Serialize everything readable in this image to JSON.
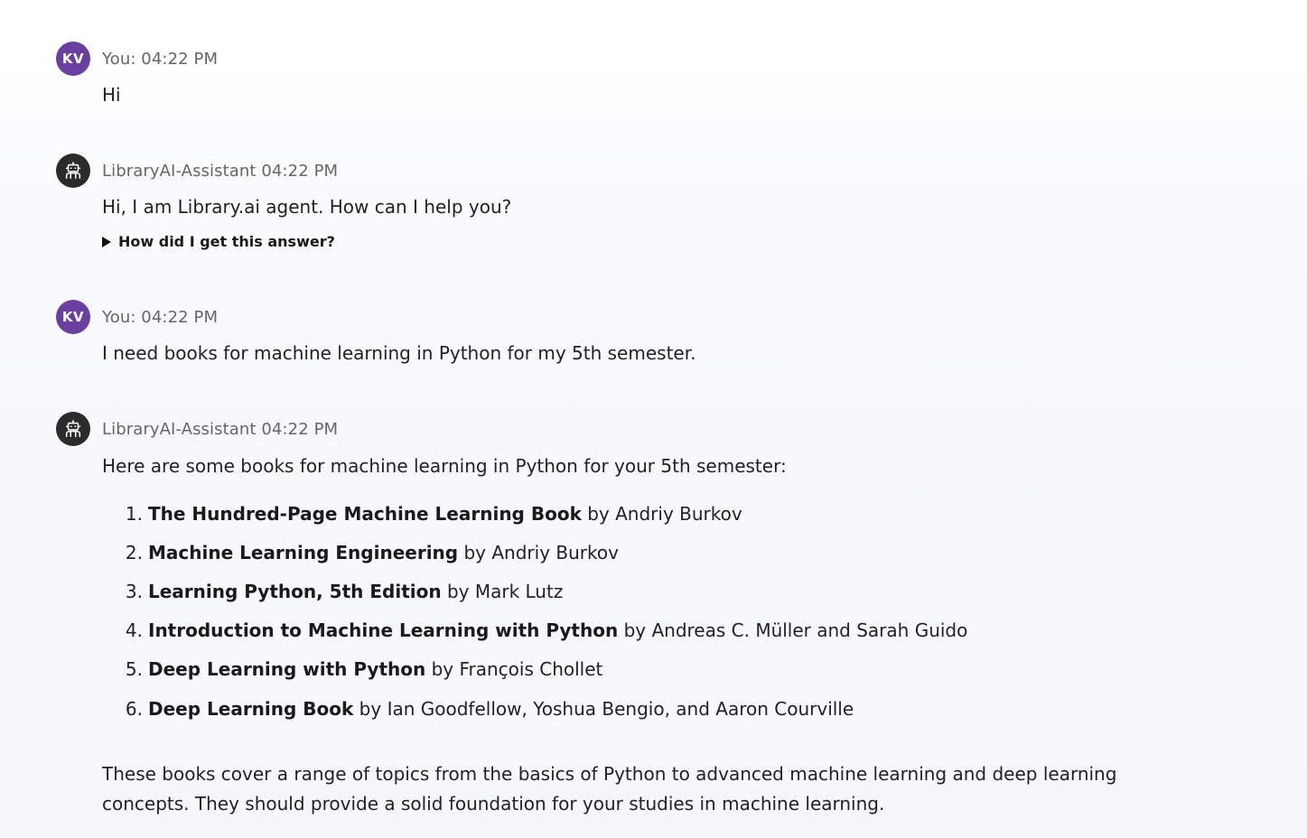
{
  "messages": [
    {
      "role": "user",
      "avatar_initials": "KV",
      "sender_label": "You: 04:22 PM",
      "text": "Hi"
    },
    {
      "role": "assistant",
      "avatar_icon": "robot-icon",
      "sender_label": "LibraryAI-Assistant 04:22 PM",
      "text": "Hi, I am Library.ai agent. How can I help you?",
      "details_label": "How did I get this answer?"
    },
    {
      "role": "user",
      "avatar_initials": "KV",
      "sender_label": "You: 04:22 PM",
      "text": "I need books for machine learning in Python for my 5th semester."
    },
    {
      "role": "assistant",
      "avatar_icon": "robot-icon",
      "sender_label": "LibraryAI-Assistant 04:22 PM",
      "intro": "Here are some books for machine learning in Python for your 5th semester:",
      "books": [
        {
          "num": "1.",
          "title": "The Hundred-Page Machine Learning Book",
          "author": " by Andriy Burkov"
        },
        {
          "num": "2.",
          "title": "Machine Learning Engineering",
          "author": " by Andriy Burkov"
        },
        {
          "num": "3.",
          "title": "Learning Python, 5th Edition",
          "author": " by Mark Lutz"
        },
        {
          "num": "4.",
          "title": "Introduction to Machine Learning with Python",
          "author": " by Andreas C. Müller and Sarah Guido"
        },
        {
          "num": "5.",
          "title": "Deep Learning with Python",
          "author": " by François Chollet"
        },
        {
          "num": "6.",
          "title": "Deep Learning Book",
          "author": " by Ian Goodfellow, Yoshua Bengio, and Aaron Courville"
        }
      ],
      "outro": "These books cover a range of topics from the basics of Python to advanced machine learning and deep learning concepts. They should provide a solid foundation for your studies in machine learning."
    }
  ],
  "colors": {
    "user_avatar_bg": "#6b3fa0",
    "bot_avatar_bg": "#2b2b2b",
    "sender_text": "#666666",
    "body_text": "#222222"
  }
}
